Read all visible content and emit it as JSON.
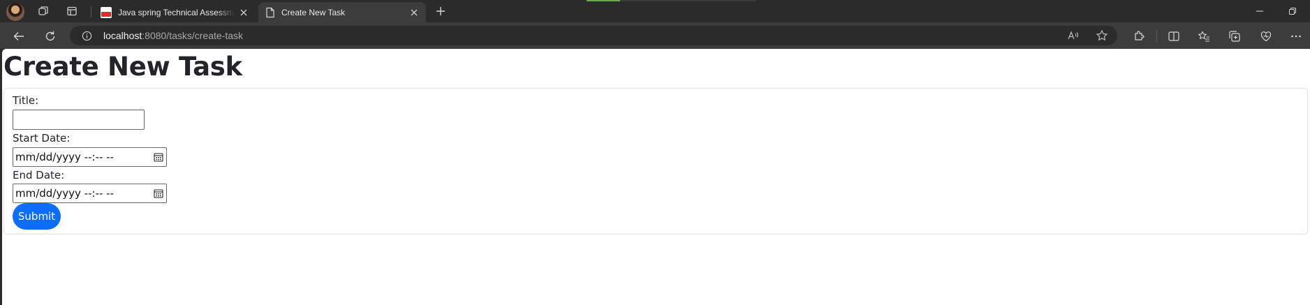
{
  "browser": {
    "tabs": [
      {
        "title": "Java spring Technical Assessment",
        "icon": "pdf-icon",
        "active": false
      },
      {
        "title": "Create New Task",
        "icon": "page-icon",
        "active": true
      }
    ],
    "address": {
      "host": "localhost",
      "rest": ":8080/tasks/create-task"
    }
  },
  "page": {
    "title": "Create New Task",
    "form": {
      "title_label": "Title:",
      "title_value": "",
      "start_label": "Start Date:",
      "start_value": "mm/dd/yyyy --:-- --",
      "end_label": "End Date:",
      "end_value": "mm/dd/yyyy --:-- --",
      "submit_label": "Submit"
    }
  },
  "colors": {
    "primary_button": "#0d6efd",
    "heading": "#212529",
    "browser_chrome": "#2b2b2b"
  }
}
